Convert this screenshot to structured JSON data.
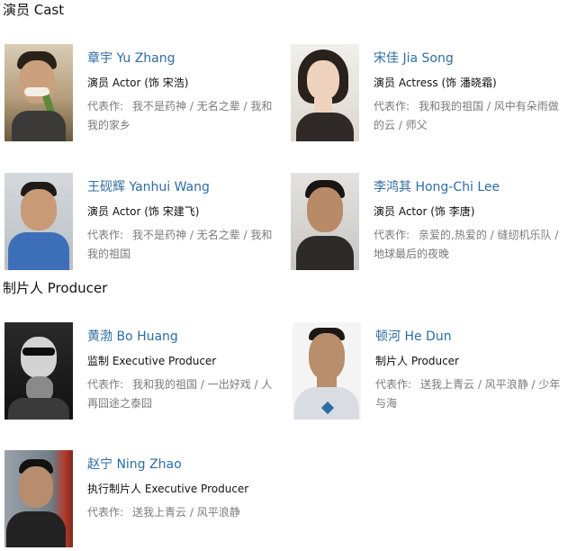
{
  "sections": {
    "cast_title": "演员 Cast",
    "producer_title": "制片人 Producer"
  },
  "works_label": "代表作:",
  "cast": [
    {
      "name": "章宇 Yu Zhang",
      "role": "演员 Actor (饰 宋浩)",
      "works": "我不是药神 / 无名之辈 / 我和我的家乡"
    },
    {
      "name": "宋佳 Jia Song",
      "role": "演员 Actress (饰 潘晓霜)",
      "works": "我和我的祖国 / 风中有朵雨做的云 / 师父"
    },
    {
      "name": "王砚辉 Yanhui Wang",
      "role": "演员 Actor (饰 宋建飞)",
      "works": "我不是药神 / 无名之辈 / 我和我的祖国"
    },
    {
      "name": "李鸿其 Hong-Chi Lee",
      "role": "演员 Actor (饰 李唐)",
      "works": "亲爱的,热爱的 / 缝纫机乐队 / 地球最后的夜晚"
    }
  ],
  "producers": [
    {
      "name": "黄渤 Bo Huang",
      "role": "监制 Executive Producer",
      "works": "我和我的祖国 / 一出好戏 / 人再囧途之泰囧"
    },
    {
      "name": "顿河 He Dun",
      "role": "制片人 Producer",
      "works": "送我上青云 / 风平浪静 / 少年与海"
    },
    {
      "name": "赵宁 Ning Zhao",
      "role": "执行制片人 Executive Producer",
      "works": "送我上青云 / 风平浪静"
    }
  ]
}
